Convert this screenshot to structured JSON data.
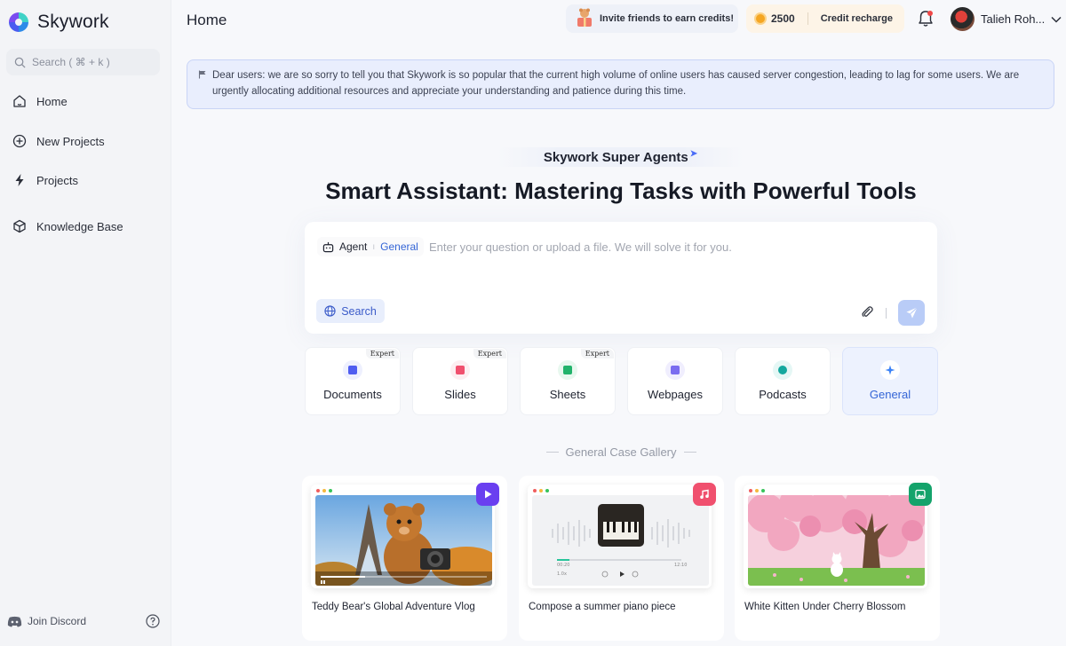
{
  "sidebar": {
    "logo_text": "Skywork",
    "search_placeholder": "Search ( ⌘ + k )",
    "items": [
      {
        "label": "Home",
        "icon": "home-icon"
      },
      {
        "label": "New Projects",
        "icon": "plus-circle-icon"
      },
      {
        "label": "Projects",
        "icon": "bolt-icon"
      },
      {
        "label": "Knowledge Base",
        "icon": "cube-icon"
      }
    ],
    "footer": {
      "discord_label": "Join Discord",
      "help_icon": "help-icon"
    }
  },
  "header": {
    "title": "Home",
    "invite_label": "Invite friends to earn credits!",
    "credits": "2500",
    "recharge_label": "Credit recharge",
    "user_name": "Talieh Roh..."
  },
  "notice": {
    "text": "Dear users: we are so sorry to tell you that Skywork is so popular that the current high volume of online users has caused server congestion, leading to lag for some users. We are urgently allocating additional resources and appreciate your understanding and patience during this time."
  },
  "hero": {
    "badge": "Skywork Super Agents",
    "title": "Smart Assistant: Mastering Tasks with Powerful Tools"
  },
  "composer": {
    "agent_label": "Agent",
    "agent_mode": "General",
    "placeholder": "Enter your question or upload a file. We will solve it for you.",
    "search_label": "Search"
  },
  "categories": [
    {
      "label": "Documents",
      "expert": "Expert",
      "color": "#4f5df0"
    },
    {
      "label": "Slides",
      "expert": "Expert",
      "color": "#f0506e"
    },
    {
      "label": "Sheets",
      "expert": "Expert",
      "color": "#22b36b"
    },
    {
      "label": "Webpages",
      "expert": "",
      "color": "#7a6cf0"
    },
    {
      "label": "Podcasts",
      "expert": "",
      "color": "#13a89e"
    },
    {
      "label": "General",
      "expert": "",
      "color": "#3b82f6"
    }
  ],
  "gallery": {
    "title": "General Case Gallery",
    "cases": [
      {
        "label": "Teddy Bear's Global Adventure Vlog",
        "badge": "video-play-icon",
        "badge_color": "#6a3ff0",
        "video_time": "0:07 / 0:35"
      },
      {
        "label": "Compose a summer piano piece",
        "badge": "music-note-icon",
        "badge_color": "#f0506e",
        "time_start": "00:20",
        "time_end": "12:10",
        "speed": "1.0x"
      },
      {
        "label": "White Kitten Under Cherry Blossom",
        "badge": "image-icon",
        "badge_color": "#14a36b"
      }
    ]
  },
  "colors": {
    "accent": "#3465d6",
    "notice_bg": "#e9eefd",
    "send_button": "#b9ccf7"
  }
}
